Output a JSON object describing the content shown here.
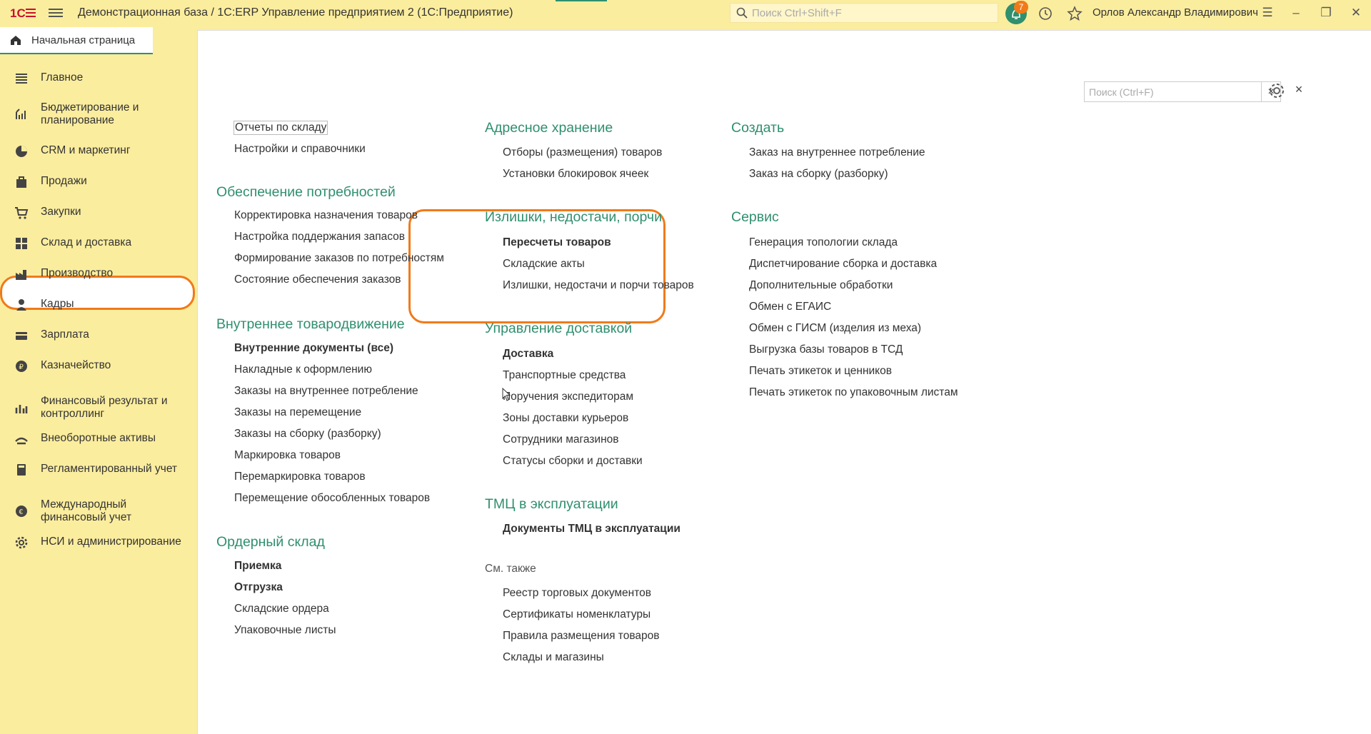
{
  "app": {
    "title": "Демонстрационная база / 1С:ERP Управление предприятием 2  (1С:Предприятие)",
    "search_placeholder": "Поиск Ctrl+Shift+F",
    "notifications_count": "7",
    "user_name": "Орлов Александр Владимирович",
    "accent_color": "#2f8f6e",
    "highlight_color": "#f07a1a"
  },
  "home_tab": {
    "label": "Начальная страница"
  },
  "sidebar": {
    "items": [
      {
        "label": "Главное",
        "icon": "list-icon"
      },
      {
        "label": "Бюджетирование и планирование",
        "icon": "budget-icon"
      },
      {
        "label": "CRM и маркетинг",
        "icon": "pie-chart-icon"
      },
      {
        "label": "Продажи",
        "icon": "bag-icon"
      },
      {
        "label": "Закупки",
        "icon": "cart-icon"
      },
      {
        "label": "Склад и доставка",
        "icon": "warehouse-icon",
        "selected": true
      },
      {
        "label": "Производство",
        "icon": "factory-icon"
      },
      {
        "label": "Кадры",
        "icon": "person-icon"
      },
      {
        "label": "Зарплата",
        "icon": "wallet-icon"
      },
      {
        "label": "Казначейство",
        "icon": "coin-icon"
      },
      {
        "label": "Финансовый результат и контроллинг",
        "icon": "bar-chart-icon"
      },
      {
        "label": "Внеоборотные активы",
        "icon": "assets-icon"
      },
      {
        "label": "Регламентированный учет",
        "icon": "calculator-icon"
      },
      {
        "label": "Международный финансовый учет",
        "icon": "globe-icon"
      },
      {
        "label": "НСИ и администрирование",
        "icon": "gear-icon"
      }
    ]
  },
  "panel": {
    "search_placeholder": "Поиск (Ctrl+F)",
    "clear": "×",
    "close": "×"
  },
  "col1": {
    "top_links": [
      "Отчеты по складу",
      "Настройки и справочники"
    ],
    "sections": [
      {
        "title": "Обеспечение потребностей",
        "links": [
          {
            "label": "Корректировка назначения товаров"
          },
          {
            "label": "Настройка поддержания запасов"
          },
          {
            "label": "Формирование заказов по потребностям"
          },
          {
            "label": "Состояние обеспечения заказов"
          }
        ]
      },
      {
        "title": "Внутреннее товародвижение",
        "links": [
          {
            "label": "Внутренние документы (все)",
            "bold": true
          },
          {
            "label": "Накладные к оформлению"
          },
          {
            "label": "Заказы на внутреннее потребление"
          },
          {
            "label": "Заказы на перемещение"
          },
          {
            "label": "Заказы на сборку (разборку)"
          },
          {
            "label": "Маркировка товаров"
          },
          {
            "label": "Перемаркировка товаров"
          },
          {
            "label": "Перемещение обособленных товаров"
          }
        ]
      },
      {
        "title": "Ордерный склад",
        "links": [
          {
            "label": "Приемка",
            "bold": true
          },
          {
            "label": "Отгрузка",
            "bold": true
          },
          {
            "label": "Складские ордера"
          },
          {
            "label": "Упаковочные листы"
          }
        ]
      }
    ]
  },
  "col2": {
    "sections": [
      {
        "title": "Адресное хранение",
        "links": [
          {
            "label": "Отборы (размещения) товаров"
          },
          {
            "label": "Установки блокировок ячеек"
          }
        ]
      },
      {
        "title": "Излишки, недостачи, порчи",
        "links": [
          {
            "label": "Пересчеты товаров",
            "bold": true
          },
          {
            "label": "Складские акты"
          },
          {
            "label": "Излишки, недостачи и порчи товаров"
          }
        ]
      },
      {
        "title": "Управление доставкой",
        "links": [
          {
            "label": "Доставка",
            "bold": true
          },
          {
            "label": "Транспортные средства"
          },
          {
            "label": "Поручения экспедиторам"
          },
          {
            "label": "Зоны доставки курьеров"
          },
          {
            "label": "Сотрудники магазинов"
          },
          {
            "label": "Статусы сборки и доставки"
          }
        ]
      },
      {
        "title": "ТМЦ в эксплуатации",
        "links": [
          {
            "label": "Документы ТМЦ в эксплуатации",
            "bold": true
          }
        ]
      }
    ],
    "see_also": {
      "title": "См. также",
      "links": [
        "Реестр торговых документов",
        "Сертификаты номенклатуры",
        "Правила размещения товаров",
        "Склады и магазины"
      ]
    }
  },
  "col3": {
    "sections": [
      {
        "title": "Создать",
        "links": [
          {
            "label": "Заказ на внутреннее потребление"
          },
          {
            "label": "Заказ на сборку (разборку)"
          }
        ]
      },
      {
        "title": "Сервис",
        "links": [
          {
            "label": "Генерация топологии склада"
          },
          {
            "label": "Диспетчирование сборка и доставка"
          },
          {
            "label": "Дополнительные обработки"
          },
          {
            "label": "Обмен с ЕГАИС"
          },
          {
            "label": "Обмен с ГИСМ (изделия из меха)"
          },
          {
            "label": "Выгрузка базы товаров в ТСД"
          },
          {
            "label": "Печать этикеток и ценников"
          },
          {
            "label": "Печать этикеток по упаковочным листам"
          }
        ]
      }
    ]
  }
}
